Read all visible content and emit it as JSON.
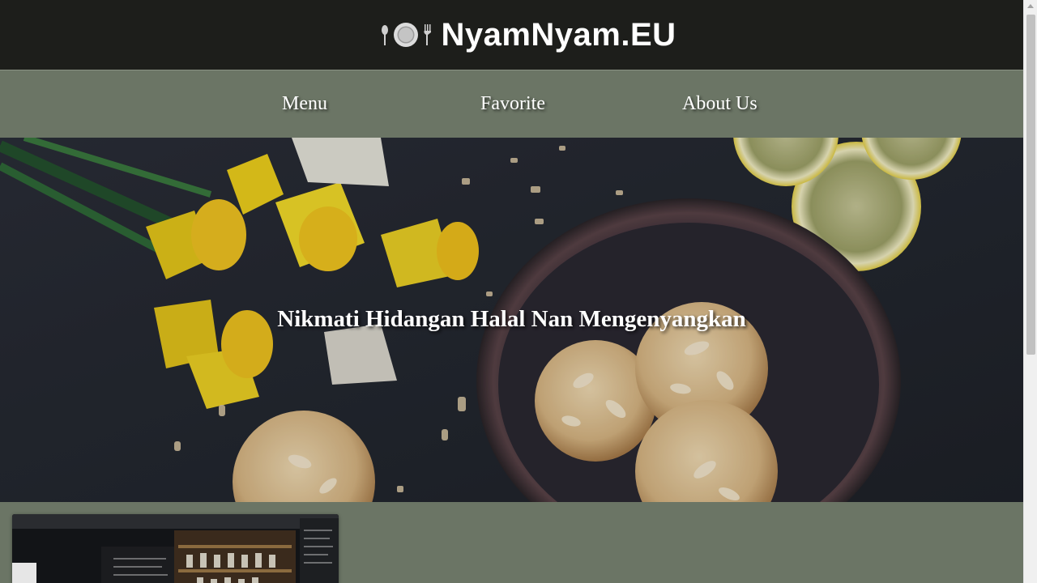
{
  "header": {
    "brand_icon": "plate-fork-knife-icon",
    "brand_name": "NyamNyam.EU"
  },
  "nav": {
    "items": [
      {
        "label": "Menu"
      },
      {
        "label": "Favorite"
      },
      {
        "label": "About Us"
      }
    ]
  },
  "hero": {
    "tagline": "Nikmati Hidangan Halal Nan Mengenyangkan",
    "image": "cookies-daffodils-lemon-photo"
  },
  "cards": [
    {
      "image": "cafe-interior-shelves-photo"
    }
  ],
  "colors": {
    "header_bg": "#1d1e1b",
    "nav_bg": "#6b7565",
    "text": "#ffffff"
  }
}
